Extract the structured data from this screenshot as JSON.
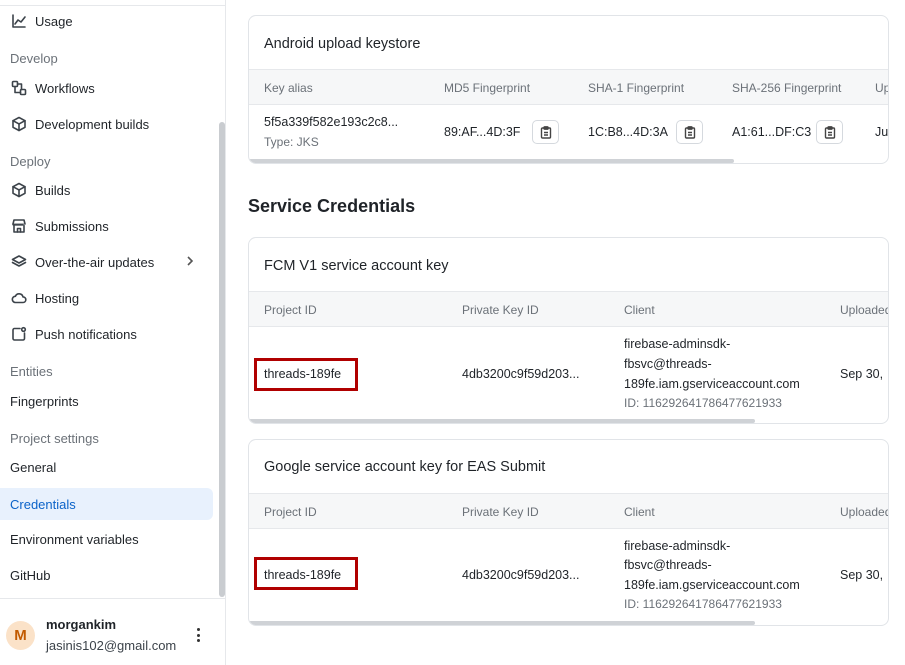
{
  "sidebar": {
    "items": {
      "usage": "Usage",
      "workflows": "Workflows",
      "development_builds": "Development builds",
      "builds": "Builds",
      "submissions": "Submissions",
      "ota_updates": "Over-the-air updates",
      "hosting": "Hosting",
      "push_notifications": "Push notifications",
      "fingerprints": "Fingerprints",
      "general": "General",
      "credentials": "Credentials",
      "environment_variables": "Environment variables",
      "github": "GitHub"
    },
    "sections": {
      "develop": "Develop",
      "deploy": "Deploy",
      "entities": "Entities",
      "project_settings": "Project settings"
    },
    "active_item": "Credentials",
    "user": {
      "initial": "M",
      "name": "morgankim",
      "email": "jasinis102@gmail.com"
    }
  },
  "keystore": {
    "title": "Android upload keystore",
    "columns": [
      "Key alias",
      "MD5 Fingerprint",
      "SHA-1 Fingerprint",
      "SHA-256 Fingerprint",
      "Up"
    ],
    "row": {
      "alias": "5f5a339f582e193c2c8...",
      "type": "Type: JKS",
      "md5": "89:AF...4D:3F",
      "sha1": "1C:B8...4D:3A",
      "sha256": "A1:61...DF:C3",
      "uploaded": "Ju"
    }
  },
  "service_credentials": {
    "title": "Service Credentials",
    "fcm": {
      "title": "FCM V1 service account key",
      "columns": [
        "Project ID",
        "Private Key ID",
        "Client",
        "Uploaded"
      ],
      "row": {
        "project_id": "threads-189fe",
        "private_key_id": "4db3200c9f59d203...",
        "client_line1": "firebase-adminsdk-",
        "client_line2": "fbsvc@threads-",
        "client_line3": "189fe.iam.gserviceaccount.com",
        "client_id": "ID: 116292641786477621933",
        "uploaded": "Sep 30,"
      }
    },
    "google": {
      "title": "Google service account key for EAS Submit",
      "columns": [
        "Project ID",
        "Private Key ID",
        "Client",
        "Uploaded"
      ],
      "row": {
        "project_id": "threads-189fe",
        "private_key_id": "4db3200c9f59d203...",
        "client_line1": "firebase-adminsdk-",
        "client_line2": "fbsvc@threads-",
        "client_line3": "189fe.iam.gserviceaccount.com",
        "client_id": "ID: 116292641786477621933",
        "uploaded": "Sep 30,"
      }
    }
  },
  "colors": {
    "accent": "#0b63c9",
    "active_bg": "#e8f1fd",
    "highlight": "#b00000"
  }
}
